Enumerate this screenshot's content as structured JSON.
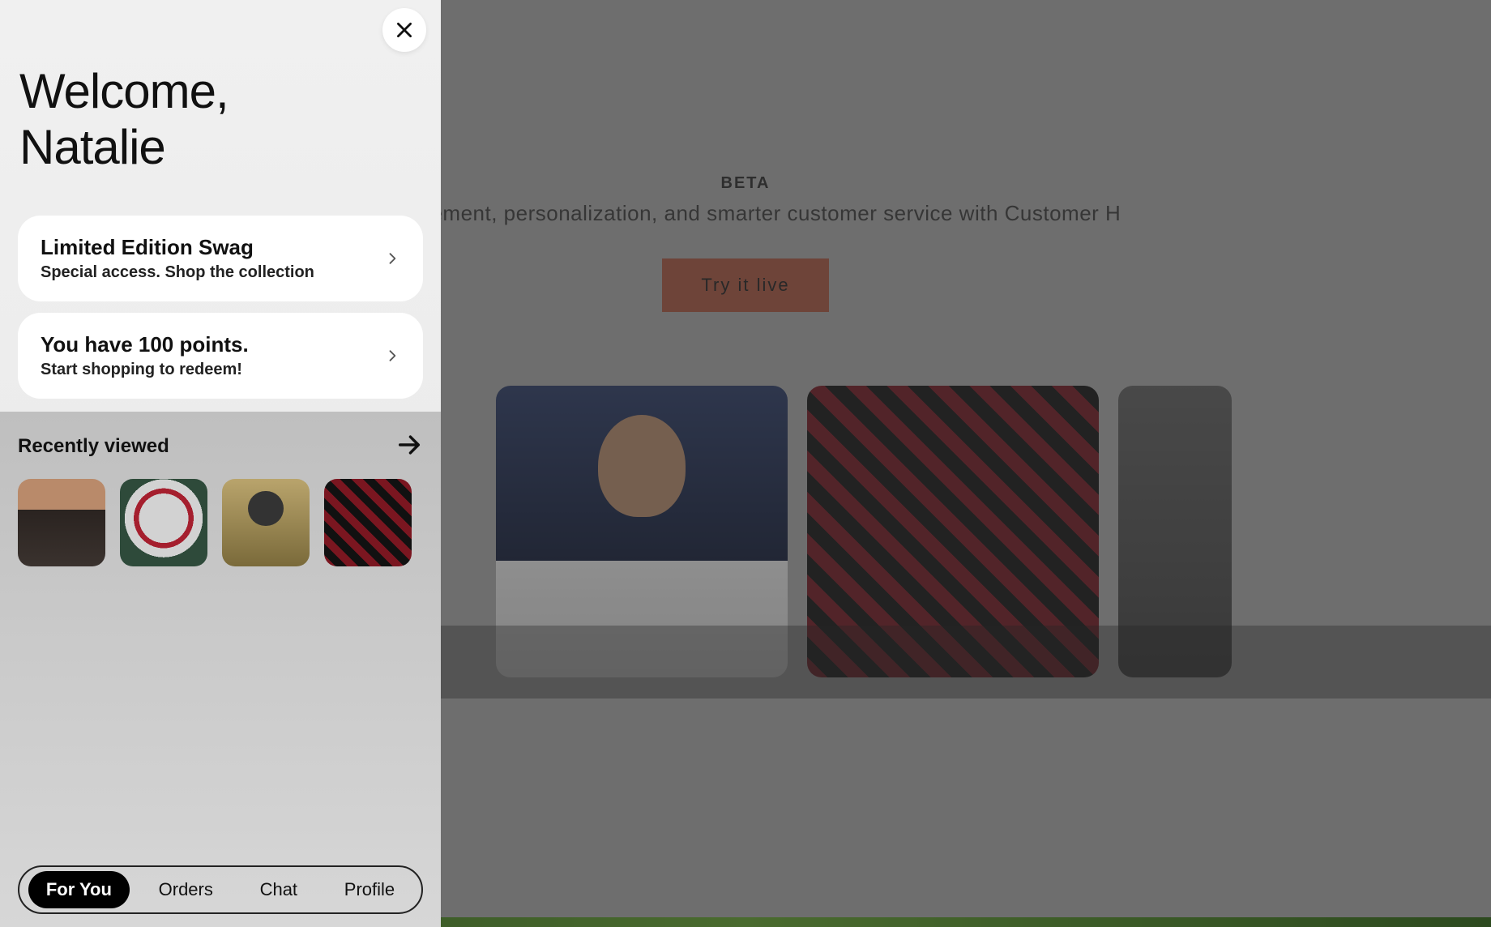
{
  "background": {
    "beta_badge": "BETA",
    "tagline": "engagement, personalization, and smarter customer service with Customer H",
    "cta_label": "Try it live"
  },
  "drawer": {
    "welcome_line1": "Welcome,",
    "welcome_line2": "Natalie",
    "cards": [
      {
        "title": "Limited Edition Swag",
        "subtitle": "Special access. Shop the collection"
      },
      {
        "title": "You have 100 points.",
        "subtitle": "Start shopping to redeem!"
      }
    ],
    "recently_viewed": {
      "heading": "Recently viewed"
    },
    "tabs": [
      {
        "label": "For You",
        "active": true
      },
      {
        "label": "Orders",
        "active": false
      },
      {
        "label": "Chat",
        "active": false
      },
      {
        "label": "Profile",
        "active": false
      }
    ]
  }
}
